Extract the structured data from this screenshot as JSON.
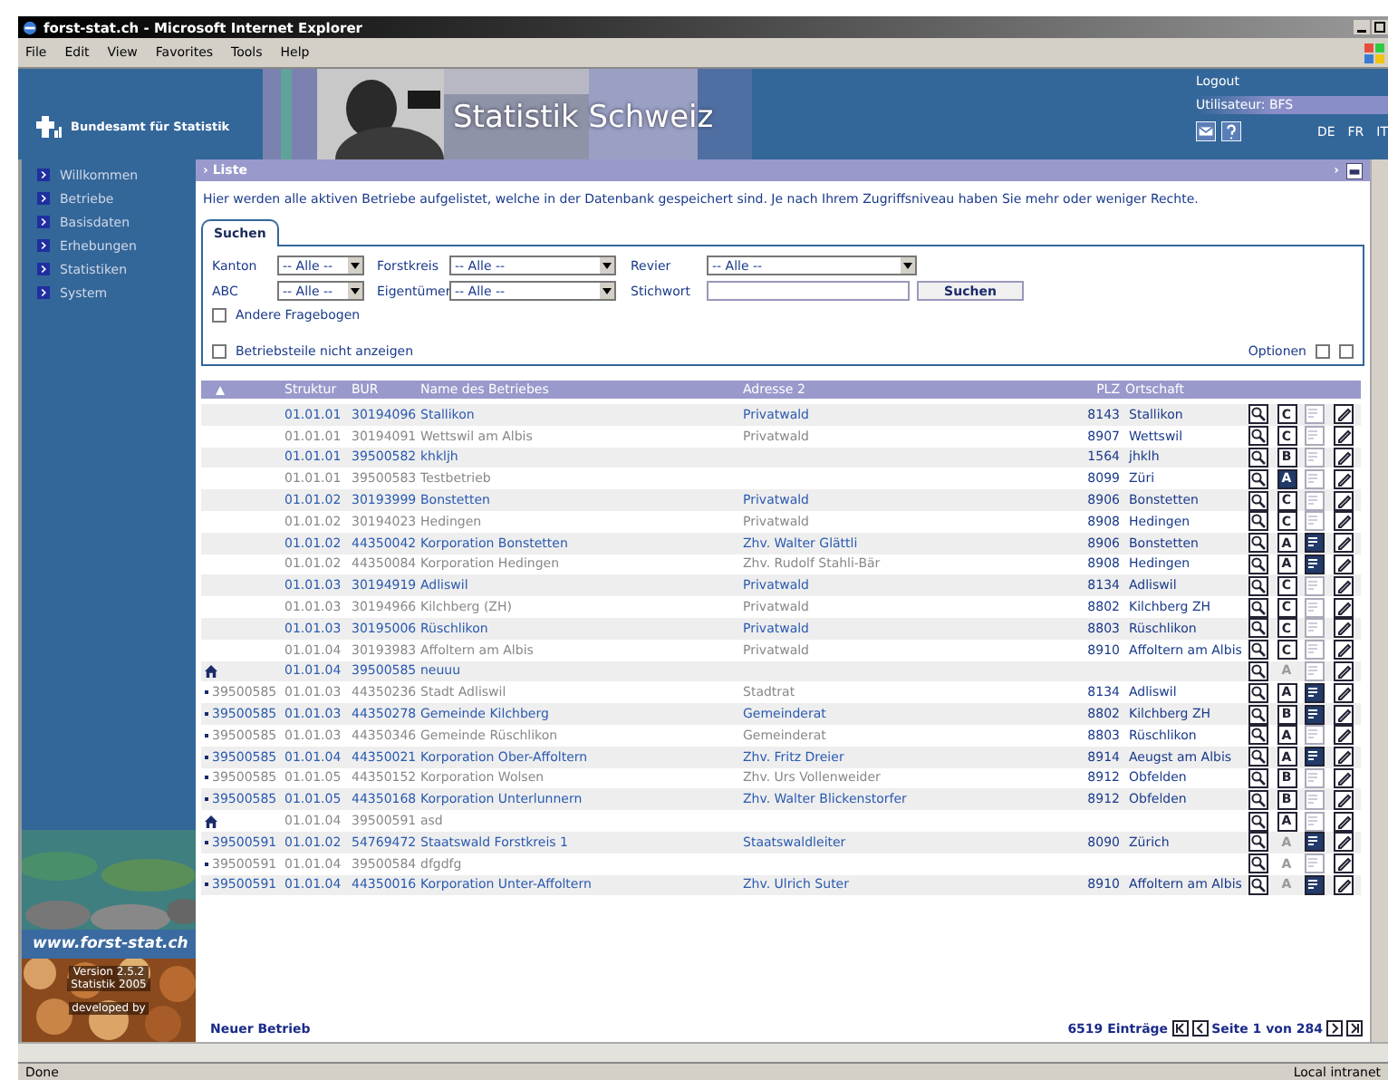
{
  "browser": {
    "title": "forst-stat.ch - Microsoft Internet Explorer",
    "menu": [
      "File",
      "Edit",
      "View",
      "Favorites",
      "Tools",
      "Help"
    ],
    "status": "Done",
    "zone": "Local intranet"
  },
  "header": {
    "org": "Bundesamt für Statistik",
    "site_title": "Statistik Schweiz",
    "logout": "Logout",
    "user": "Utilisateur: BFS",
    "languages": [
      "DE",
      "FR",
      "IT"
    ]
  },
  "sidebar": {
    "items": [
      "Willkommen",
      "Betriebe",
      "Basisdaten",
      "Erhebungen",
      "Statistiken",
      "System"
    ],
    "site_url": "www.forst-stat.ch",
    "version_lines": [
      "Version 2.5.2",
      "Statistik 2005"
    ],
    "credit": "developed by"
  },
  "panel": {
    "title": "› Liste",
    "collapse_marker": "›",
    "intro": "Hier werden alle aktiven Betriebe aufgelistet, welche in der Datenbank gespeichert sind. Je nach Ihrem Zugriffsniveau haben Sie mehr oder weniger Rechte.",
    "search_tab": "Suchen",
    "filters": [
      {
        "label": "Kanton",
        "value": "-- Alle --",
        "kind": "short"
      },
      {
        "label": "Forstkreis",
        "value": "-- Alle --",
        "kind": "medium"
      },
      {
        "label": "Revier",
        "value": "-- Alle --",
        "kind": "long"
      },
      {
        "label": "ABC",
        "value": "-- Alle --",
        "kind": "short"
      },
      {
        "label": "Eigentümer",
        "value": "-- Alle --",
        "kind": "medium"
      }
    ],
    "keyword_label": "Stichwort",
    "search_button": "Suchen",
    "checkboxes": [
      {
        "label": "Andere Fragebogen",
        "checked": false
      },
      {
        "label": "Betriebsteile nicht anzeigen",
        "checked": false
      }
    ],
    "options": {
      "label": "Optionen",
      "checks": [
        {
          "checked": false
        },
        {
          "checked": false
        }
      ]
    }
  },
  "table": {
    "columns": [
      "Struktur",
      "BUR",
      "Name des Betriebes",
      "Adresse 2",
      "PLZ",
      "Ortschaft"
    ],
    "rows": [
      {
        "kind": "plain",
        "struktur": "01.01.01",
        "bur": "30194096",
        "name": "Stallikon",
        "address": "Privatwald",
        "plz": "8143",
        "place": "Stallikon",
        "badge": {
          "letter": "C",
          "filled": false,
          "disabled": false
        },
        "report": false
      },
      {
        "kind": "plain",
        "struktur": "01.01.01",
        "bur": "30194091",
        "name": "Wettswil am Albis",
        "address": "Privatwald",
        "plz": "8907",
        "place": "Wettswil",
        "badge": {
          "letter": "C",
          "filled": false,
          "disabled": false
        },
        "report": false
      },
      {
        "kind": "plain",
        "struktur": "01.01.01",
        "bur": "39500582",
        "name": "khkljh",
        "plz": "1564",
        "place": "jhklh",
        "badge": {
          "letter": "B",
          "filled": false,
          "disabled": false
        },
        "report": false
      },
      {
        "kind": "plain",
        "struktur": "01.01.01",
        "bur": "39500583",
        "name": "Testbetrieb",
        "plz": "8099",
        "place": "Züri",
        "badge": {
          "letter": "A",
          "filled": true,
          "disabled": false
        },
        "report": false
      },
      {
        "kind": "plain",
        "struktur": "01.01.02",
        "bur": "30193999",
        "name": "Bonstetten",
        "address": "Privatwald",
        "plz": "8906",
        "place": "Bonstetten",
        "badge": {
          "letter": "C",
          "filled": false,
          "disabled": false
        },
        "report": false
      },
      {
        "kind": "plain",
        "struktur": "01.01.02",
        "bur": "30194023",
        "name": "Hedingen",
        "address": "Privatwald",
        "plz": "8908",
        "place": "Hedingen",
        "badge": {
          "letter": "C",
          "filled": false,
          "disabled": false
        },
        "report": false
      },
      {
        "kind": "plain",
        "struktur": "01.01.02",
        "bur": "44350042",
        "name": "Korporation Bonstetten",
        "address": "Zhv. Walter Glättli",
        "plz": "8906",
        "place": "Bonstetten",
        "badge": {
          "letter": "A",
          "filled": false,
          "disabled": false
        },
        "report": true
      },
      {
        "kind": "plain",
        "struktur": "01.01.02",
        "bur": "44350084",
        "name": "Korporation Hedingen",
        "address": "Zhv. Rudolf Stahli-Bär",
        "plz": "8908",
        "place": "Hedingen",
        "badge": {
          "letter": "A",
          "filled": false,
          "disabled": false
        },
        "report": true
      },
      {
        "kind": "plain",
        "struktur": "01.01.03",
        "bur": "30194919",
        "name": "Adliswil",
        "address": "Privatwald",
        "plz": "8134",
        "place": "Adliswil",
        "badge": {
          "letter": "C",
          "filled": false,
          "disabled": false
        },
        "report": false
      },
      {
        "kind": "plain",
        "struktur": "01.01.03",
        "bur": "30194966",
        "name": "Kilchberg (ZH)",
        "address": "Privatwald",
        "plz": "8802",
        "place": "Kilchberg ZH",
        "badge": {
          "letter": "C",
          "filled": false,
          "disabled": false
        },
        "report": false
      },
      {
        "kind": "plain",
        "struktur": "01.01.03",
        "bur": "30195006",
        "name": "Rüschlikon",
        "address": "Privatwald",
        "plz": "8803",
        "place": "Rüschlikon",
        "badge": {
          "letter": "C",
          "filled": false,
          "disabled": false
        },
        "report": false
      },
      {
        "kind": "plain",
        "struktur": "01.01.04",
        "bur": "30193983",
        "name": "Affoltern am Albis",
        "address": "Privatwald",
        "plz": "8910",
        "place": "Affoltern am Albis",
        "badge": {
          "letter": "C",
          "filled": false,
          "disabled": false
        },
        "report": false
      },
      {
        "kind": "home",
        "struktur": "01.01.04",
        "bur": "39500585",
        "name": "neuuu",
        "badge": {
          "letter": "A",
          "filled": false,
          "disabled": true
        },
        "report": false
      },
      {
        "kind": "child",
        "parent": "39500585",
        "struktur": "01.01.03",
        "bur": "44350236",
        "name": "Stadt Adliswil",
        "address": "Stadtrat",
        "plz": "8134",
        "place": "Adliswil",
        "badge": {
          "letter": "A",
          "filled": false,
          "disabled": false
        },
        "report": true
      },
      {
        "kind": "child",
        "parent": "39500585",
        "struktur": "01.01.03",
        "bur": "44350278",
        "name": "Gemeinde Kilchberg",
        "address": "Gemeinderat",
        "plz": "8802",
        "place": "Kilchberg ZH",
        "badge": {
          "letter": "B",
          "filled": false,
          "disabled": false
        },
        "report": true
      },
      {
        "kind": "child",
        "parent": "39500585",
        "struktur": "01.01.03",
        "bur": "44350346",
        "name": "Gemeinde Rüschlikon",
        "address": "Gemeinderat",
        "plz": "8803",
        "place": "Rüschlikon",
        "badge": {
          "letter": "A",
          "filled": false,
          "disabled": false
        },
        "report": false
      },
      {
        "kind": "child",
        "parent": "39500585",
        "struktur": "01.01.04",
        "bur": "44350021",
        "name": "Korporation Ober-Affoltern",
        "address": "Zhv. Fritz Dreier",
        "plz": "8914",
        "place": "Aeugst am Albis",
        "badge": {
          "letter": "A",
          "filled": false,
          "disabled": false
        },
        "report": true
      },
      {
        "kind": "child",
        "parent": "39500585",
        "struktur": "01.01.05",
        "bur": "44350152",
        "name": "Korporation Wolsen",
        "address": "Zhv. Urs Vollenweider",
        "plz": "8912",
        "place": "Obfelden",
        "badge": {
          "letter": "B",
          "filled": false,
          "disabled": false
        },
        "report": false
      },
      {
        "kind": "child",
        "parent": "39500585",
        "struktur": "01.01.05",
        "bur": "44350168",
        "name": "Korporation Unterlunnern",
        "address": "Zhv. Walter Blickenstorfer",
        "plz": "8912",
        "place": "Obfelden",
        "badge": {
          "letter": "B",
          "filled": false,
          "disabled": false
        },
        "report": false
      },
      {
        "kind": "home",
        "struktur": "01.01.04",
        "bur": "39500591",
        "name": "asd",
        "badge": {
          "letter": "A",
          "filled": false,
          "disabled": false
        },
        "report": false
      },
      {
        "kind": "child",
        "parent": "39500591",
        "struktur": "01.01.02",
        "bur": "54769472",
        "name": "Staatswald Forstkreis 1",
        "address": "Staatswaldleiter",
        "plz": "8090",
        "place": "Zürich",
        "badge": {
          "letter": "A",
          "filled": false,
          "disabled": true
        },
        "report": true
      },
      {
        "kind": "child",
        "parent": "39500591",
        "struktur": "01.01.04",
        "bur": "39500584",
        "name": "dfgdfg",
        "badge": {
          "letter": "A",
          "filled": false,
          "disabled": true
        },
        "report": false
      },
      {
        "kind": "child",
        "parent": "39500591",
        "struktur": "01.01.04",
        "bur": "44350016",
        "name": "Korporation Unter-Affoltern",
        "address": "Zhv. Ulrich Suter",
        "plz": "8910",
        "place": "Affoltern am Albis",
        "badge": {
          "letter": "A",
          "filled": false,
          "disabled": true
        },
        "report": true
      }
    ]
  },
  "footer": {
    "new_link": "Neuer Betrieb",
    "count": "6519 Einträge",
    "page": "Seite 1 von 284"
  }
}
